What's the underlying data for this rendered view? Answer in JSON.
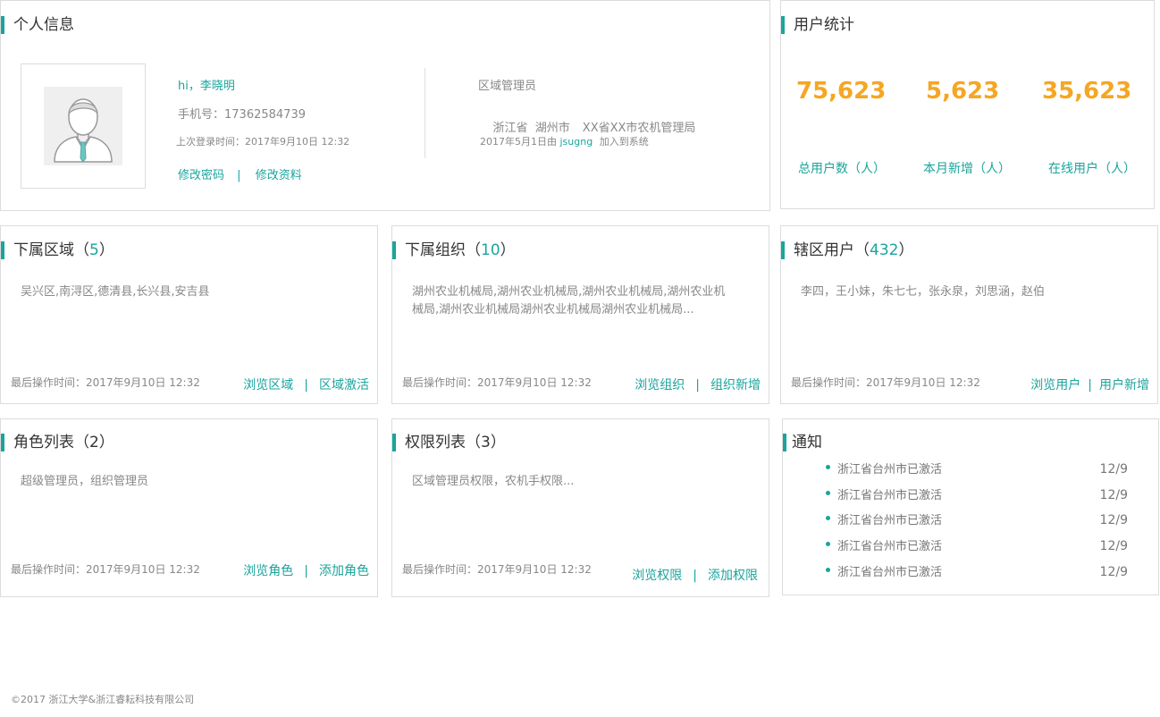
{
  "profile": {
    "title": "个人信息",
    "greeting": "hi，李晓明",
    "phone": "手机号：17362584739",
    "last_login": "上次登录时间：2017年9月10日 12:32",
    "change_password": "修改密码",
    "link_separator": "|",
    "edit_profile": "修改资料",
    "role": "区域管理员",
    "location": "浙江省  湖州市",
    "organization": "XX省XX市农机管理局",
    "added_date": "2017年5月1日由",
    "added_by": "jsugng",
    "added_suffix": "加入到系统"
  },
  "stats": {
    "title": "用户统计",
    "items": [
      {
        "value": "75,623",
        "label": "总用户数（人）"
      },
      {
        "value": "5,623",
        "label": "本月新增（人）"
      },
      {
        "value": "35,623",
        "label": "在线用户（人）"
      }
    ]
  },
  "regions": {
    "title": "下属区域（",
    "count": "5",
    "close": "）",
    "desc": "吴兴区,南浔区,德清县,长兴县,安吉县",
    "last_op": "最后操作时间：2017年9月10日 12:32",
    "action1": "浏览区域",
    "sep": "|",
    "action2": "区域激活"
  },
  "orgs": {
    "title": "下属组织（",
    "count": "10",
    "close": "）",
    "desc": "湖州农业机械局,湖州农业机械局,湖州农业机械局,湖州农业机械局,湖州农业机械局湖州农业机械局湖州农业机械局...",
    "last_op": "最后操作时间：2017年9月10日 12:32",
    "action1": "浏览组织",
    "sep": "|",
    "action2": "组织新增"
  },
  "users": {
    "title": "辖区用户（",
    "count": "432",
    "close": "）",
    "desc": "李四，王小妹，朱七七，张永泉，刘思涵，赵伯",
    "last_op": "最后操作时间：2017年9月10日 12:32",
    "action1": "浏览用户",
    "sep": "|",
    "action2": "用户新增"
  },
  "roles": {
    "title": "角色列表（2）",
    "desc": "超级管理员，组织管理员",
    "last_op": "最后操作时间：2017年9月10日 12:32",
    "action1": "浏览角色",
    "sep": "|",
    "action2": "添加角色"
  },
  "perms": {
    "title": "权限列表（3）",
    "desc": "区域管理员权限，农机手权限...",
    "last_op": "最后操作时间：2017年9月10日 12:32",
    "action1": "浏览权限",
    "sep": "|",
    "action2": "添加权限"
  },
  "notice": {
    "title": "通知",
    "items": [
      {
        "text": "浙江省台州市已激活",
        "date": "12/9"
      },
      {
        "text": "浙江省台州市已激活",
        "date": "12/9"
      },
      {
        "text": "浙江省台州市已激活",
        "date": "12/9"
      },
      {
        "text": "浙江省台州市已激活",
        "date": "12/9"
      },
      {
        "text": "浙江省台州市已激活",
        "date": "12/9"
      }
    ]
  },
  "footer": "©2017 浙江大学&浙江睿耘科技有限公司",
  "colors": {
    "accent": "#1aa49c",
    "number": "#f5a623"
  }
}
